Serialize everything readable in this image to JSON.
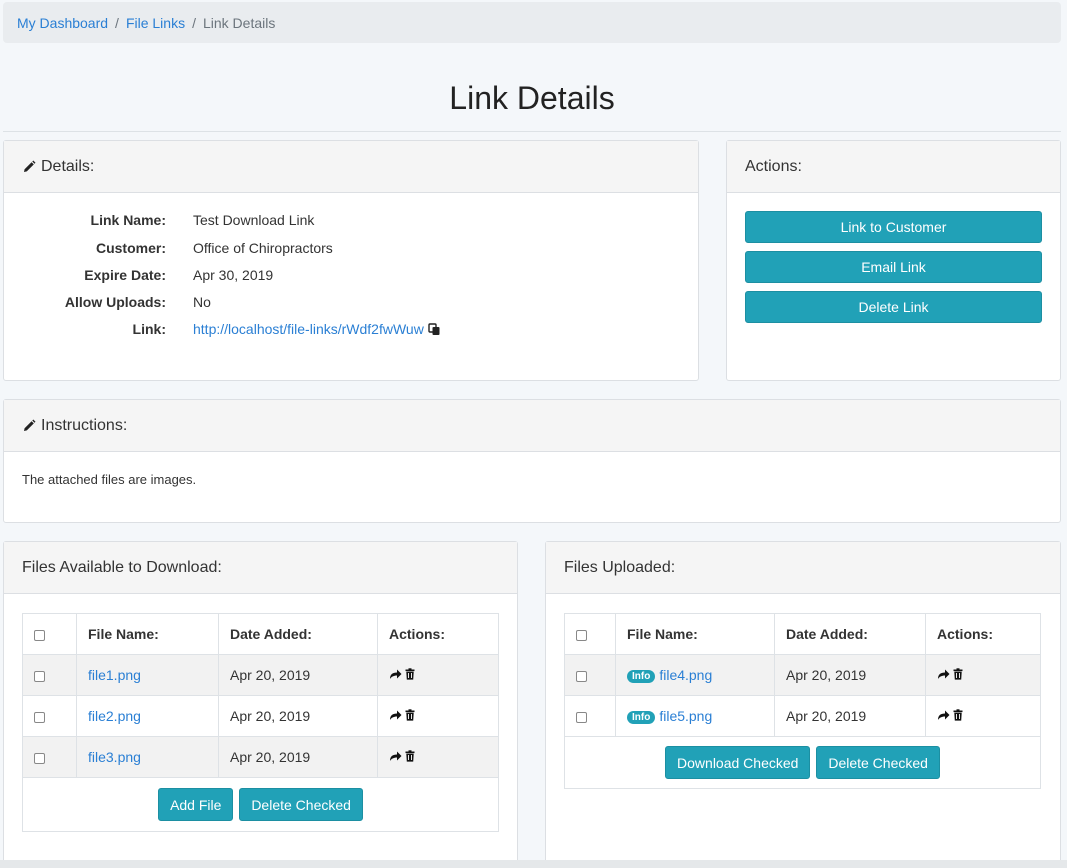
{
  "breadcrumb": {
    "items": [
      {
        "label": "My Dashboard"
      },
      {
        "label": "File Links"
      }
    ],
    "separator": "/",
    "current": "Link Details"
  },
  "page": {
    "title": "Link Details"
  },
  "details": {
    "heading": "Details:",
    "rows": [
      {
        "label": "Link Name:",
        "value": "Test Download Link"
      },
      {
        "label": "Customer:",
        "value": "Office of Chiropractors"
      },
      {
        "label": "Expire Date:",
        "value": "Apr 30, 2019"
      },
      {
        "label": "Allow Uploads:",
        "value": "No"
      },
      {
        "label": "Link:",
        "value": "http://localhost/file-links/rWdf2fwWuw"
      }
    ]
  },
  "actions": {
    "heading": "Actions:",
    "buttons": [
      {
        "label": "Link to Customer"
      },
      {
        "label": "Email Link"
      },
      {
        "label": "Delete Link"
      }
    ]
  },
  "instructions": {
    "heading": "Instructions:",
    "text": "The attached files are images."
  },
  "downloads": {
    "heading": "Files Available to Download:",
    "columns": [
      "File Name:",
      "Date Added:",
      "Actions:"
    ],
    "rows": [
      {
        "file": "file1.png",
        "date": "Apr 20, 2019"
      },
      {
        "file": "file2.png",
        "date": "Apr 20, 2019"
      },
      {
        "file": "file3.png",
        "date": "Apr 20, 2019"
      }
    ],
    "add_label": "Add File",
    "delete_label": "Delete Checked"
  },
  "uploads": {
    "heading": "Files Uploaded:",
    "columns": [
      "File Name:",
      "Date Added:",
      "Actions:"
    ],
    "rows": [
      {
        "badge": "Info",
        "file": "file4.png",
        "date": "Apr 20, 2019"
      },
      {
        "badge": "Info",
        "file": "file5.png",
        "date": "Apr 20, 2019"
      }
    ],
    "download_label": "Download Checked",
    "delete_label": "Delete Checked"
  },
  "icons": {
    "pencil": "pencil-icon",
    "copy": "copy-icon",
    "share": "share-icon",
    "trash": "trash-icon"
  },
  "colors": {
    "accent": "#21a1b7",
    "link": "#2a7fd4",
    "panel_header": "#f5f5f5",
    "page_background": "#f4f7fa"
  }
}
